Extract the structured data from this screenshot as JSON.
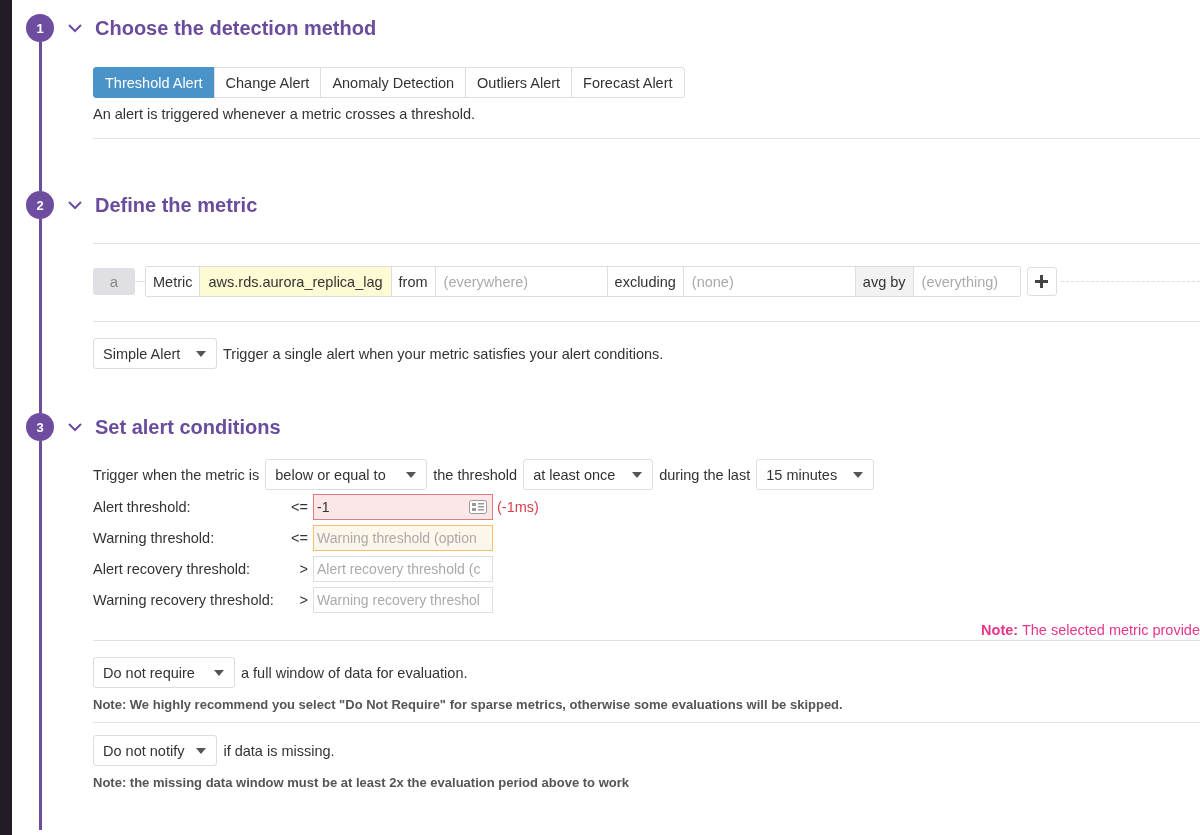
{
  "steps": [
    {
      "number": "1",
      "title": "Choose the detection method",
      "expanded": true
    },
    {
      "number": "2",
      "title": "Define the metric",
      "expanded": true
    },
    {
      "number": "3",
      "title": "Set alert conditions",
      "expanded": true
    }
  ],
  "detection": {
    "tabs": [
      {
        "label": "Threshold Alert",
        "selected": true
      },
      {
        "label": "Change Alert",
        "selected": false
      },
      {
        "label": "Anomaly Detection",
        "selected": false
      },
      {
        "label": "Outliers Alert",
        "selected": false
      },
      {
        "label": "Forecast Alert",
        "selected": false
      }
    ],
    "description": "An alert is triggered whenever a metric crosses a threshold."
  },
  "metric": {
    "query_label": "a",
    "segments": [
      {
        "kind": "metric",
        "label": "Metric",
        "value": "aws.rds.aurora_replica_lag"
      },
      {
        "kind": "filter",
        "label": "from",
        "placeholder": "(everywhere)"
      },
      {
        "kind": "filter",
        "label": "excluding",
        "placeholder": "(none)"
      },
      {
        "kind": "group",
        "label": "avg by",
        "placeholder": "(everything)"
      }
    ],
    "alert_type": "Simple Alert",
    "alert_type_description": "Trigger a single alert when your metric satisfies your alert conditions."
  },
  "conditions": {
    "trigger_prefix": "Trigger when the metric is",
    "comparison": "below or equal to",
    "middle": "the threshold",
    "occurrence": "at least once",
    "window_prefix": "during the last",
    "window": "15 minutes",
    "thresholds": [
      {
        "label": "Alert threshold:",
        "operator": "<=",
        "kind": "error",
        "value": "-1",
        "hint": "(-1ms)"
      },
      {
        "label": "Warning threshold:",
        "operator": "<=",
        "kind": "warning",
        "placeholder": "Warning threshold (option"
      },
      {
        "label": "Alert recovery threshold:",
        "operator": ">",
        "kind": "plain",
        "placeholder": "Alert recovery threshold (c"
      },
      {
        "label": "Warning recovery threshold:",
        "operator": ">",
        "kind": "plain",
        "placeholder": "Warning recovery threshol"
      }
    ],
    "metric_note": "**Note:** The selected metric provide",
    "full_window": "Do not require",
    "full_window_text": "a full window of data for evaluation.",
    "full_window_note": "Note: We highly recommend you select \"Do Not Require\" for sparse metrics, otherwise some evaluations will be skipped.",
    "missing": "Do not notify",
    "missing_text": "if data is missing.",
    "missing_note": "Note: the missing data window must be at least 2x the evaluation period above to work"
  }
}
